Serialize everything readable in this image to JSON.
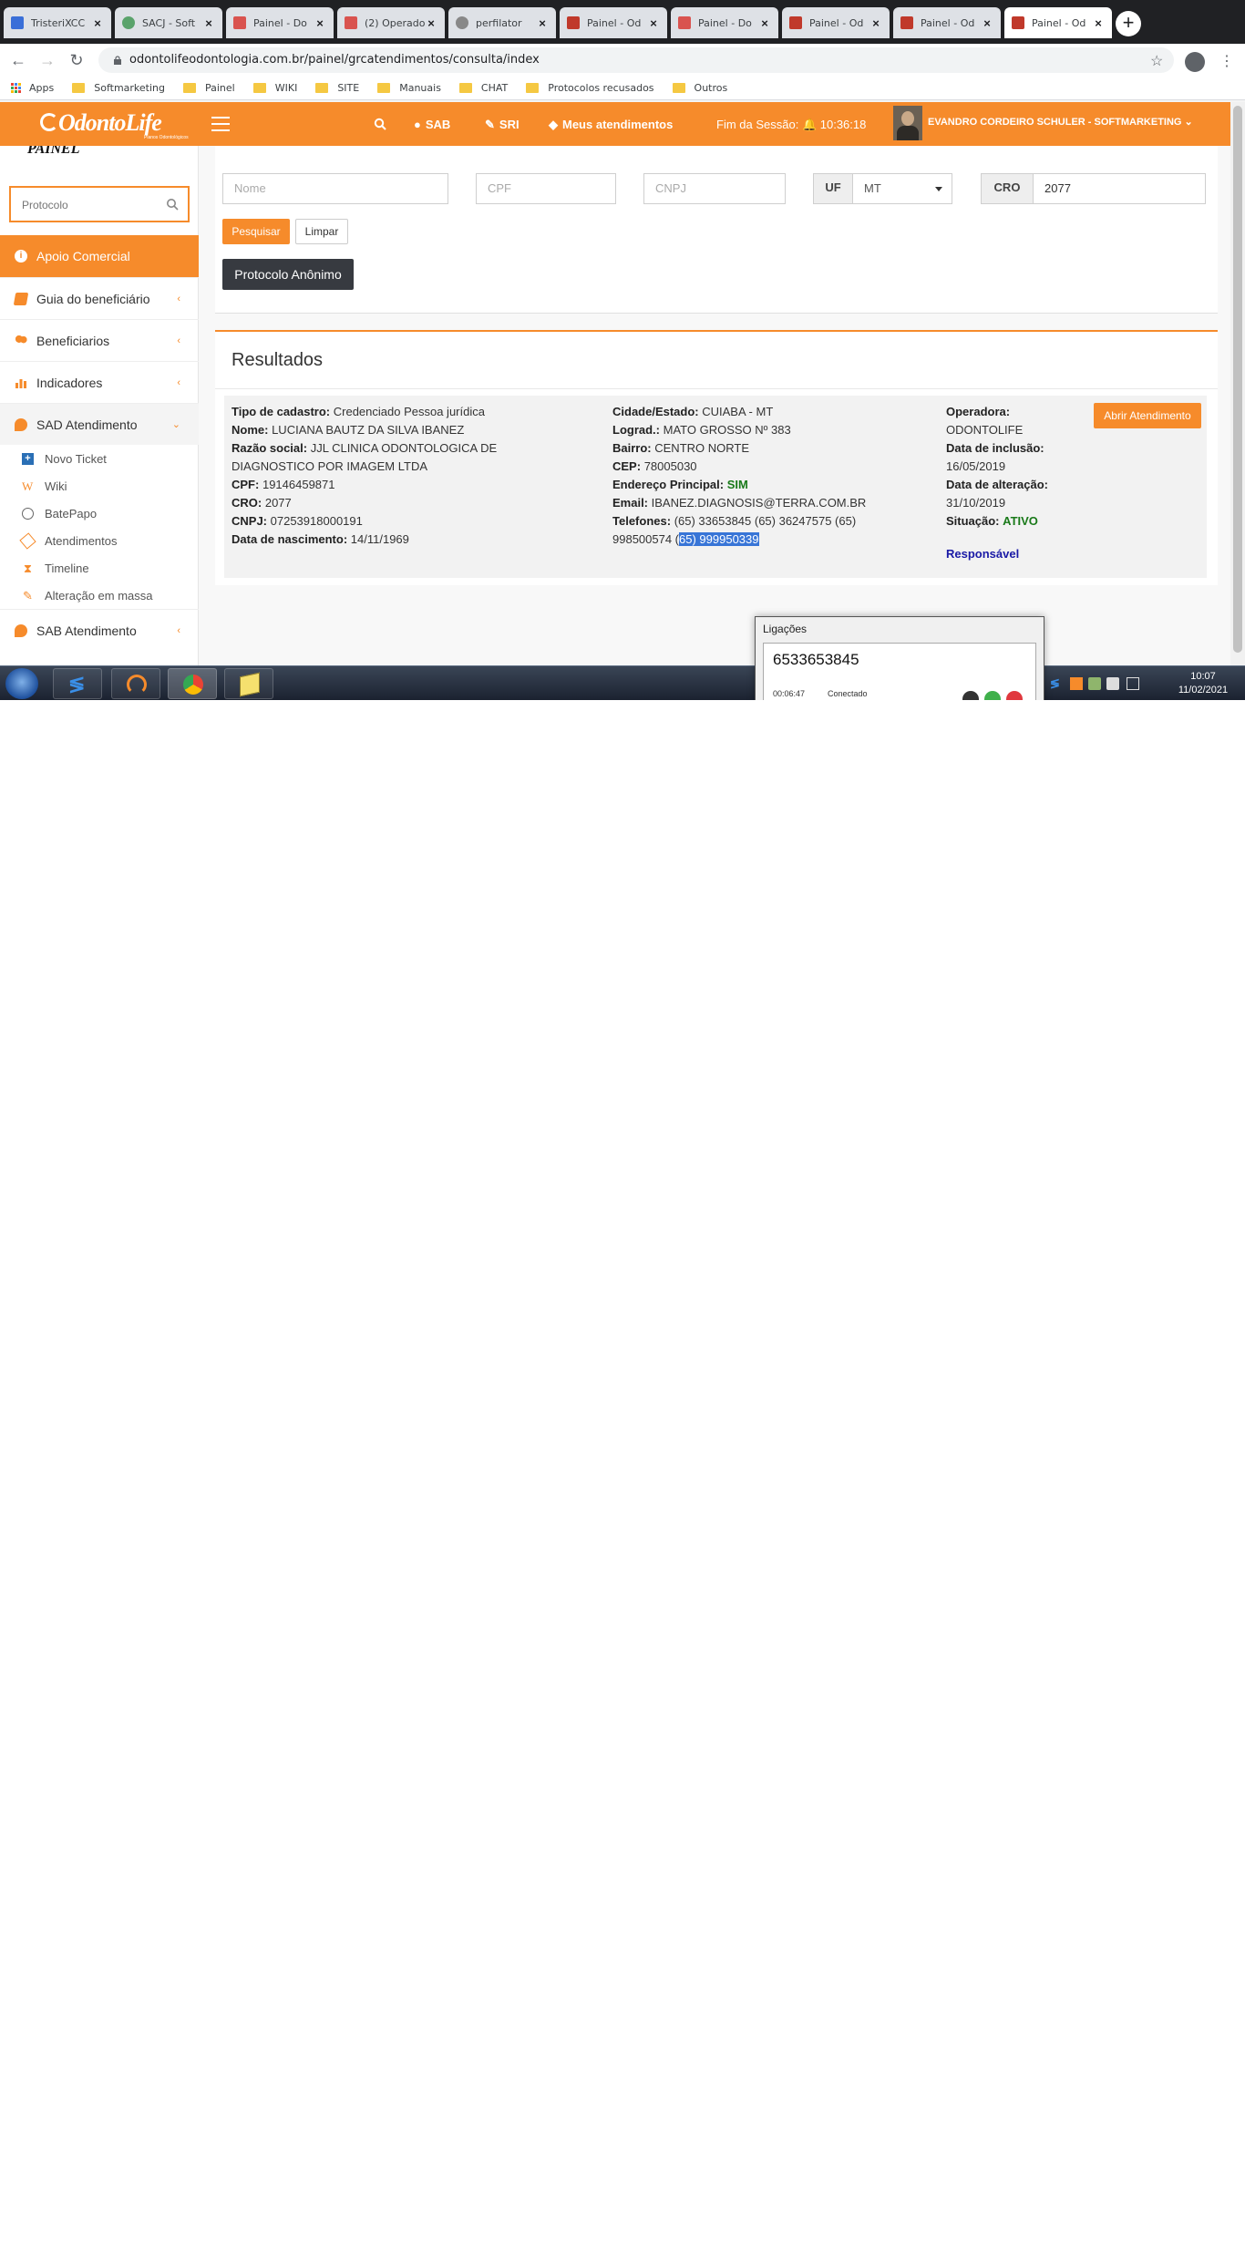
{
  "browser": {
    "tabs": [
      {
        "title": "TristeriXCC",
        "favicon_color": "#3a6fd8",
        "active": false
      },
      {
        "title": "SACJ - Soft",
        "favicon_color": "#5aa36b",
        "active": false
      },
      {
        "title": "Painel - Do",
        "favicon_color": "#d9534f",
        "active": false
      },
      {
        "title": "(2) Operado",
        "favicon_color": "#d9534f",
        "active": false
      },
      {
        "title": "perfilator",
        "favicon_color": "#888888",
        "active": false
      },
      {
        "title": "Painel - Od",
        "favicon_color": "#c0392b",
        "active": false
      },
      {
        "title": "Painel - Do",
        "favicon_color": "#d9534f",
        "active": false
      },
      {
        "title": "Painel - Od",
        "favicon_color": "#c0392b",
        "active": false
      },
      {
        "title": "Painel - Od",
        "favicon_color": "#c0392b",
        "active": false
      },
      {
        "title": "Painel - Od",
        "favicon_color": "#c0392b",
        "active": true
      }
    ],
    "url": "odontolifeodontologia.com.br/painel/grcatendimentos/consulta/index",
    "bookmarks": [
      "Apps",
      "Softmarketing",
      "Painel",
      "WIKI",
      "SITE",
      "Manuais",
      "CHAT",
      "Protocolos recusados",
      "Outros"
    ]
  },
  "header": {
    "logo": "OdontoLife",
    "logo_tagline": "Planos Odontológicos",
    "search_icon": "search-icon",
    "sab": "SAB",
    "sri": "SRI",
    "meus_atendimentos": "Meus atendimentos",
    "session": "Fim da Sessão: ",
    "session_time": "10:36:18",
    "user": "EVANDRO CORDEIRO SCHULER - SOFTMARKETING",
    "accent": "#f68b2b"
  },
  "sidebar": {
    "brand": "PAINEL",
    "protocol_placeholder": "Protocolo",
    "items": [
      {
        "label": "Apoio Comercial"
      },
      {
        "label": "Guia do beneficiário"
      },
      {
        "label": "Beneficiarios"
      },
      {
        "label": "Indicadores"
      },
      {
        "label": "SAD Atendimento"
      },
      {
        "label": "SAB Atendimento"
      }
    ],
    "subitems": [
      {
        "label": "Novo Ticket"
      },
      {
        "label": "Wiki"
      },
      {
        "label": "BatePapo"
      },
      {
        "label": "Atendimentos"
      },
      {
        "label": "Timeline"
      },
      {
        "label": "Alteração em massa"
      }
    ]
  },
  "search": {
    "nome_placeholder": "Nome",
    "cpf_placeholder": "CPF",
    "cnpj_placeholder": "CNPJ",
    "uf_label": "UF",
    "uf_value": "MT",
    "cro_label": "CRO",
    "cro_value": "2077",
    "pesquisar": "Pesquisar",
    "limpar": "Limpar",
    "protocolo_anonimo": "Protocolo Anônimo"
  },
  "results": {
    "title": "Resultados",
    "labels": {
      "tipo": "Tipo de cadastro:",
      "nome": "Nome:",
      "razao": "Razão social:",
      "cpf": "CPF:",
      "cro": "CRO:",
      "cnpj": "CNPJ:",
      "nascimento": "Data de nascimento:",
      "cidade": "Cidade/Estado:",
      "lograd": "Lograd.:",
      "bairro": "Bairro:",
      "cep": "CEP:",
      "endereco_principal": "Endereço Principal:",
      "email": "Email:",
      "telefones": "Telefones:",
      "operadora": "Operadora:",
      "inclusao": "Data de inclusão:",
      "alteracao": "Data de alteração:",
      "situacao": "Situação:"
    },
    "values": {
      "tipo": "Credenciado Pessoa jurídica",
      "nome": "LUCIANA BAUTZ DA SILVA IBANEZ",
      "razao_line1": "JJL CLINICA ODONTOLOGICA DE",
      "razao_line2": "DIAGNOSTICO POR IMAGEM LTDA",
      "cpf": "19146459871",
      "cro": "2077",
      "cnpj": "07253918000191",
      "nascimento": "14/11/1969",
      "cidade": "CUIABA - MT",
      "lograd": "MATO GROSSO Nº 383",
      "bairro": "CENTRO NORTE",
      "cep": "78005030",
      "endereco_principal": "SIM",
      "email": "IBANEZ.DIAGNOSIS@TERRA.COM.BR",
      "telefones_line1": "(65) 33653845 (65) 36247575 (65)",
      "telefones_line2_plain": "998500574 (",
      "telefones_line2_selected": "65) 999950339",
      "operadora": "ODONTOLIFE",
      "inclusao": "16/05/2019",
      "alteracao": "31/10/2019",
      "situacao": "ATIVO"
    },
    "abrir_atendimento": "Abrir Atendimento",
    "responsavel": "Responsável"
  },
  "phone": {
    "title": "Ligações",
    "number": "6533653845",
    "timer": "00:06:47",
    "status": "Conectado"
  },
  "taskbar": {
    "time": "10:07",
    "date": "11/02/2021"
  }
}
